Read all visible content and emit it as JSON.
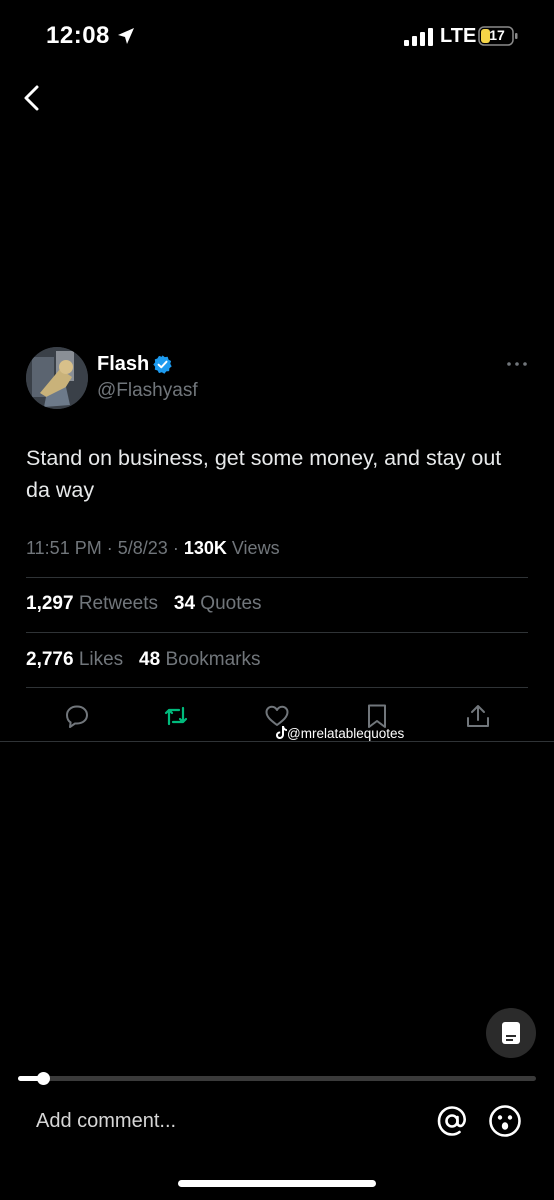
{
  "status_bar": {
    "time": "12:08",
    "network": "LTE",
    "battery": "17"
  },
  "tweet": {
    "author_name": "Flash",
    "handle": "@Flashyasf",
    "text": "Stand on business, get some money, and stay out da way",
    "time": "11:51 PM",
    "date": "5/8/23",
    "views_count": "130K",
    "views_label": "Views",
    "retweets_count": "1,297",
    "retweets_label": "Retweets",
    "quotes_count": "34",
    "quotes_label": "Quotes",
    "likes_count": "2,776",
    "likes_label": "Likes",
    "bookmarks_count": "48",
    "bookmarks_label": "Bookmarks"
  },
  "watermark": "@mrelatablequotes",
  "comment_bar": {
    "placeholder": "Add comment..."
  },
  "colors": {
    "background": "#000000",
    "verified": "#1d9bf0",
    "retweet_icon": "#00ba7c",
    "secondary_text": "#71767b",
    "battery": "#f5d547"
  },
  "icons": [
    "location-arrow-icon",
    "signal-icon",
    "battery-icon",
    "back-chevron-icon",
    "verified-badge-icon",
    "more-icon",
    "reply-icon",
    "retweet-icon",
    "like-icon",
    "bookmark-icon",
    "share-icon",
    "tiktok-icon",
    "captions-icon",
    "at-icon",
    "emoji-icon"
  ]
}
